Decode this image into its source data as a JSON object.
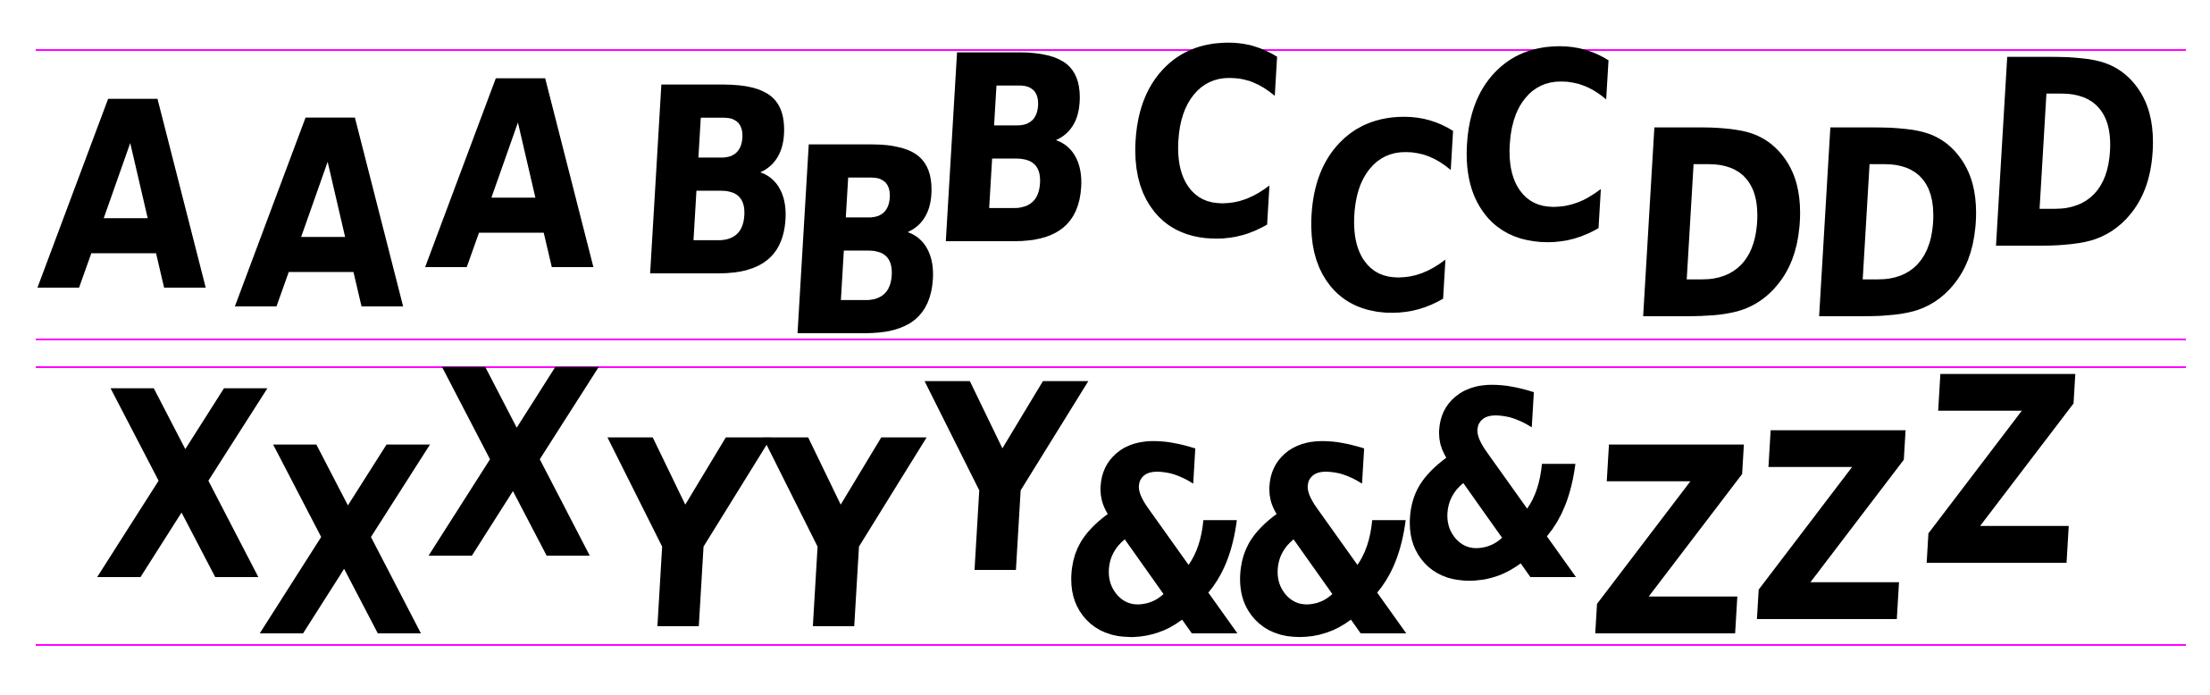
{
  "guide_color": "#ff00ff",
  "rows": [
    {
      "glyphs": [
        "A",
        "A",
        "A",
        "B",
        "B",
        "B",
        "C",
        "C",
        "C",
        "D",
        "D",
        "D"
      ]
    },
    {
      "glyphs": [
        "X",
        "X",
        "X",
        "Y",
        "Y",
        "Y",
        "&",
        "&",
        "&",
        "Z",
        "Z",
        "Z"
      ]
    }
  ]
}
